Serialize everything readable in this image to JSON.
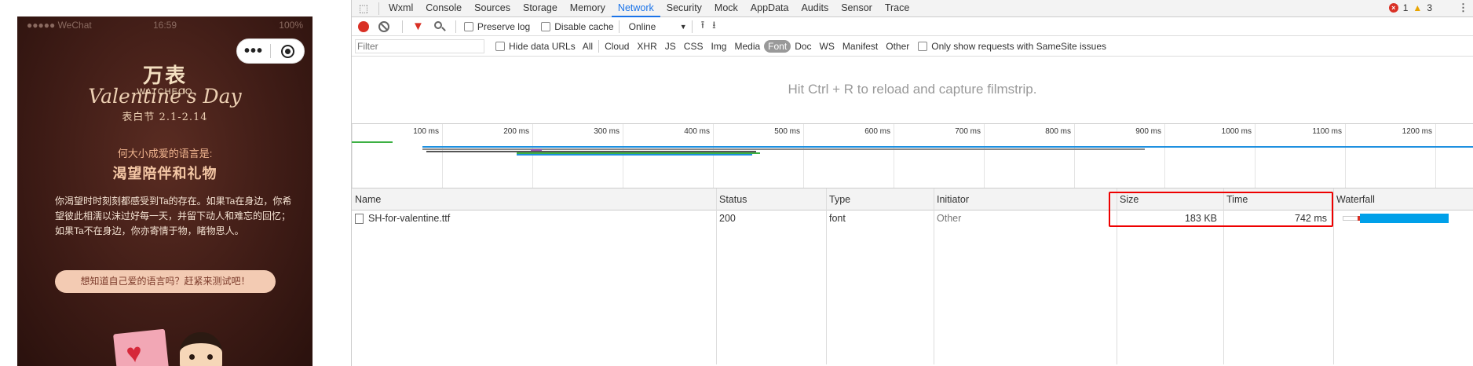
{
  "phone": {
    "status": {
      "carrier": "●●●●● WeChat",
      "time": "16:59",
      "battery": "100%"
    },
    "brand": {
      "cn": "万表",
      "en": "WATCHECO"
    },
    "script_title": "Valentine's Day",
    "date_line": "表白节 2.1-2.14",
    "question": "何大小成爱的语言是:",
    "answer": "渴望陪伴和礼物",
    "paragraph": "你渴望时时刻刻都感受到Ta的存在。如果Ta在身边，你希望彼此相濡以沫过好每一天，并留下动人和难忘的回忆；如果Ta不在身边，你亦寄情于物，睹物思人。",
    "cta": "想知道自己爱的语言吗？赶紧来测试吧！",
    "capsule": {
      "menu": "•••"
    }
  },
  "devtools": {
    "tabs": [
      "Wxml",
      "Console",
      "Sources",
      "Storage",
      "Memory",
      "Network",
      "Security",
      "Mock",
      "AppData",
      "Audits",
      "Sensor",
      "Trace"
    ],
    "active_tab": "Network",
    "error_count": "1",
    "warning_count": "3",
    "toolbar": {
      "preserve_log": "Preserve log",
      "disable_cache": "Disable cache",
      "throttle": "Online"
    },
    "filter": {
      "placeholder": "Filter",
      "hide_data": "Hide data URLs",
      "types": [
        "All",
        "Cloud",
        "XHR",
        "JS",
        "CSS",
        "Img",
        "Media",
        "Font",
        "Doc",
        "WS",
        "Manifest",
        "Other"
      ],
      "active_type": "Font",
      "samesite": "Only show requests with SameSite issues"
    },
    "banner": "Hit Ctrl + R to reload and capture filmstrip.",
    "timeline_ticks": [
      "100 ms",
      "200 ms",
      "300 ms",
      "400 ms",
      "500 ms",
      "600 ms",
      "700 ms",
      "800 ms",
      "900 ms",
      "1000 ms",
      "1100 ms",
      "1200 ms"
    ],
    "columns": [
      "Name",
      "Status",
      "Type",
      "Initiator",
      "Size",
      "Time",
      "Waterfall"
    ],
    "rows": [
      {
        "name": "SH-for-valentine.ttf",
        "status": "200",
        "type": "font",
        "initiator": "Other",
        "size": "183 KB",
        "time": "742 ms"
      }
    ],
    "colors": {
      "accent": "#1a73e8",
      "error": "#d93025",
      "highlight": "#e00000",
      "waterfall": "#00a0e9"
    }
  }
}
